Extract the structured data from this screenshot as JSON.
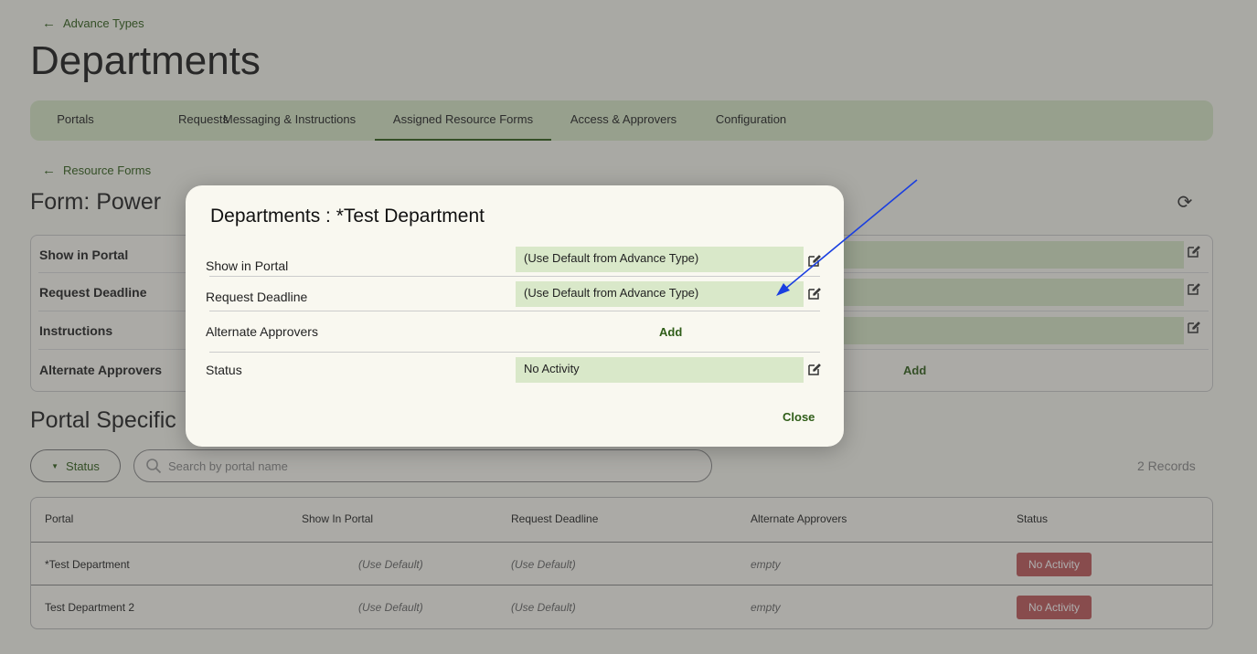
{
  "header": {
    "back_label": "Advance Types",
    "title": "Departments"
  },
  "tabs": [
    {
      "label": "Portals",
      "active": false
    },
    {
      "label": "Requests",
      "active": false
    },
    {
      "label": "Messaging & Instructions",
      "active": false
    },
    {
      "label": "Assigned Resource Forms",
      "active": true
    },
    {
      "label": "Access & Approvers",
      "active": false
    },
    {
      "label": "Configuration",
      "active": false
    }
  ],
  "form": {
    "back_label": "Resource Forms",
    "title": "Form: Power",
    "settings": [
      {
        "label": "Show in Portal"
      },
      {
        "label": "Request Deadline"
      },
      {
        "label": "Instructions"
      },
      {
        "label": "Alternate Approvers",
        "action": "Add"
      }
    ]
  },
  "portal_specific": {
    "title": "Portal Specific",
    "status_filter": "Status",
    "search_placeholder": "Search by portal name",
    "record_count": "2 Records",
    "columns": [
      "Portal",
      "Show In Portal",
      "Request Deadline",
      "Alternate Approvers",
      "Status"
    ],
    "rows": [
      {
        "portal": "*Test Department",
        "show_in_portal": "(Use Default)",
        "request_deadline": "(Use Default)",
        "alternate_approvers": "empty",
        "status": "No Activity"
      },
      {
        "portal": "Test Department 2",
        "show_in_portal": "(Use Default)",
        "request_deadline": "(Use Default)",
        "alternate_approvers": "empty",
        "status": "No Activity"
      }
    ]
  },
  "modal": {
    "title": "Departments : *Test Department",
    "rows": [
      {
        "label": "Show in Portal",
        "value": "(Use Default from Advance Type)"
      },
      {
        "label": "Request Deadline",
        "value": "(Use Default from Advance Type)"
      },
      {
        "label": "Alternate Approvers",
        "action": "Add"
      },
      {
        "label": "Status",
        "value": "No Activity"
      }
    ],
    "close_label": "Close"
  },
  "colors": {
    "accent": "#2f5d18",
    "field_bg": "#d9e8c9",
    "status_badge": "#c0595b",
    "annotation_arrow": "#1a3fe0"
  },
  "icons": [
    "back-arrow-icon",
    "refresh-icon",
    "edit-icon",
    "search-icon",
    "caret-down-icon"
  ]
}
